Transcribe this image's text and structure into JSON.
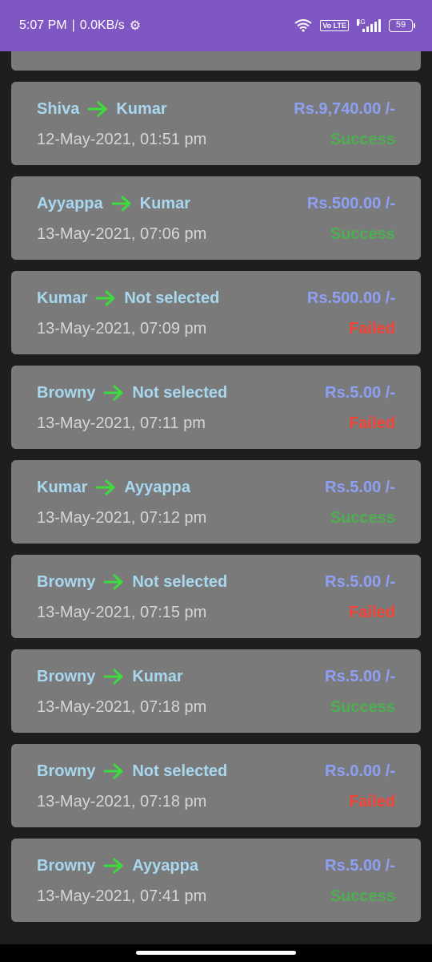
{
  "status_bar": {
    "time": "5:07 PM",
    "speed": "0.0KB/s",
    "network_tag": "4G",
    "volte": "Vo LTE",
    "battery": "59"
  },
  "transactions": [
    {
      "from": "Shiva",
      "to": "Kumar",
      "amount": "Rs.9,740.00 /-",
      "datetime": "12-May-2021, 01:51 pm",
      "status": "Success"
    },
    {
      "from": "Ayyappa",
      "to": "Kumar",
      "amount": "Rs.500.00 /-",
      "datetime": "13-May-2021, 07:06 pm",
      "status": "Success"
    },
    {
      "from": "Kumar",
      "to": "Not selected",
      "amount": "Rs.500.00 /-",
      "datetime": "13-May-2021, 07:09 pm",
      "status": "Failed"
    },
    {
      "from": "Browny",
      "to": "Not selected",
      "amount": "Rs.5.00 /-",
      "datetime": "13-May-2021, 07:11 pm",
      "status": "Failed"
    },
    {
      "from": "Kumar",
      "to": "Ayyappa",
      "amount": "Rs.5.00 /-",
      "datetime": "13-May-2021, 07:12 pm",
      "status": "Success"
    },
    {
      "from": "Browny",
      "to": "Not selected",
      "amount": "Rs.5.00 /-",
      "datetime": "13-May-2021, 07:15 pm",
      "status": "Failed"
    },
    {
      "from": "Browny",
      "to": "Kumar",
      "amount": "Rs.5.00 /-",
      "datetime": "13-May-2021, 07:18 pm",
      "status": "Success"
    },
    {
      "from": "Browny",
      "to": "Not selected",
      "amount": "Rs.0.00 /-",
      "datetime": "13-May-2021, 07:18 pm",
      "status": "Failed"
    },
    {
      "from": "Browny",
      "to": "Ayyappa",
      "amount": "Rs.5.00 /-",
      "datetime": "13-May-2021, 07:41 pm",
      "status": "Success"
    }
  ],
  "colors": {
    "status_bar": "#7e57c2",
    "card": "#7a7a7a",
    "name": "#a8d8f0",
    "amount": "#8ea0f5",
    "success": "#4caf50",
    "failed": "#f44336",
    "arrow": "#3ddc3d"
  }
}
